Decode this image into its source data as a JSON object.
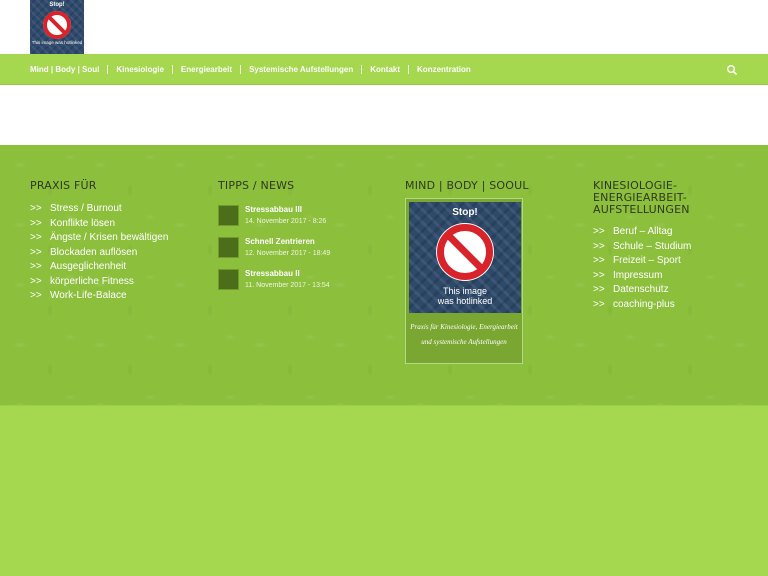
{
  "logo": {
    "stop": "Stop!",
    "sub": "This image was hotlinked"
  },
  "nav": {
    "items": [
      "Mind | Body | Soul",
      "Kinesiologie",
      "Energiearbeit",
      "Systemische Aufstellungen",
      "Kontakt",
      "Konzentration"
    ]
  },
  "footer": {
    "col1": {
      "title": "PRAXIS FÜR",
      "items": [
        "Stress / Burnout",
        "Konflikte lösen",
        "Ängste / Krisen bewältigen",
        "Blockaden auflösen",
        "Ausgeglichenheit",
        "körperliche Fitness",
        "Work-Life-Balace"
      ]
    },
    "col2": {
      "title": "TIPPS / NEWS",
      "items": [
        {
          "title": "Stressabbau III",
          "date": "14. November 2017 - 8:26"
        },
        {
          "title": "Schnell Zentrieren",
          "date": "12. November 2017 - 18:49"
        },
        {
          "title": "Stressabbau II",
          "date": "11. November 2017 - 13:54"
        }
      ]
    },
    "col3": {
      "title": "MIND | BODY | SOOUL",
      "image_stop": "Stop!",
      "image_line1": "This image",
      "image_line2": "was hotlinked",
      "caption": "Praxis für Kinesiologie, Energiearbeit und systemische Aufstellungen"
    },
    "col4": {
      "title": "KINESIOLOGIE-ENERGIEARBEIT-AUFSTELLUNGEN",
      "items": [
        "Beruf – Alltag",
        "Schule – Studium",
        "Freizeit – Sport",
        "Impressum",
        "Datenschutz",
        "coaching-plus"
      ]
    },
    "arrow": ">>"
  },
  "colors": {
    "accent": "#a5d74f",
    "footer_bg": "#8cbf3c",
    "thumb": "#4c6e1b"
  },
  "icons": {
    "search": "search-icon",
    "prohibited": "prohibited-icon"
  }
}
